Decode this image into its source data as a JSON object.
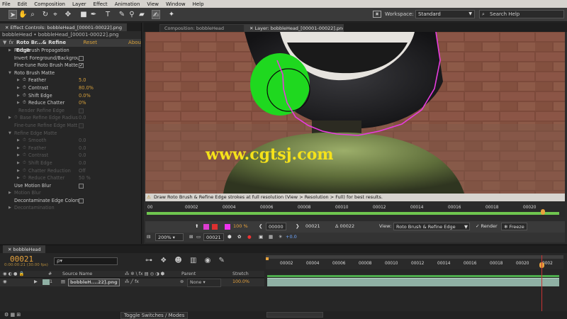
{
  "menubar": [
    "File",
    "Edit",
    "Composition",
    "Layer",
    "Effect",
    "Animation",
    "View",
    "Window",
    "Help"
  ],
  "workspace": {
    "label": "Workspace:",
    "value": "Standard"
  },
  "search": {
    "placeholder": "Search Help"
  },
  "effect_controls": {
    "tab": "Effect Controls: bobbleHead_[00001-00022].png",
    "title": "bobbleHead • bobbleHead_[00001-00022].png",
    "effect_name": "Roto Br...& Refine Edge",
    "reset": "Reset",
    "about": "Abou",
    "rows": [
      {
        "label": "Roto Brush Propagation",
        "indent": 1,
        "twirl": "right",
        "dim": false
      },
      {
        "label": "Invert Foreground/Backgrou",
        "indent": 1,
        "dim": false,
        "checkbox": false
      },
      {
        "label": "Fine-tune Roto Brush Matte",
        "indent": 1,
        "dim": false,
        "checkbox": true
      },
      {
        "label": "Roto Brush Matte",
        "indent": 1,
        "twirl": "down",
        "dim": false
      },
      {
        "label": "Feather",
        "indent": 3,
        "twirl": "right",
        "stopwatch": true,
        "value": "5.0",
        "dim": false
      },
      {
        "label": "Contrast",
        "indent": 3,
        "twirl": "right",
        "stopwatch": true,
        "value": "80.0%",
        "dim": false
      },
      {
        "label": "Shift Edge",
        "indent": 3,
        "twirl": "right",
        "stopwatch": true,
        "value": "0.0%",
        "dim": false
      },
      {
        "label": "Reduce Chatter",
        "indent": 3,
        "twirl": "right",
        "stopwatch": true,
        "value": "0%",
        "dim": false
      },
      {
        "label": "Render Refine Edge",
        "indent": 2,
        "dim": true,
        "checkbox": false
      },
      {
        "label": "Base Refine Edge Radius",
        "indent": 1,
        "twirl": "right",
        "stopwatch": true,
        "value": "0.0",
        "dim": true
      },
      {
        "label": "Fine-tune Refine Edge Matt",
        "indent": 1,
        "dim": true,
        "checkbox": false
      },
      {
        "label": "Refine Edge Matte",
        "indent": 1,
        "twirl": "down",
        "dim": true
      },
      {
        "label": "Smooth",
        "indent": 3,
        "twirl": "right",
        "stopwatch": true,
        "value": "0.0",
        "dim": true
      },
      {
        "label": "Feather",
        "indent": 3,
        "twirl": "right",
        "stopwatch": true,
        "value": "0.0",
        "dim": true
      },
      {
        "label": "Contrast",
        "indent": 3,
        "twirl": "right",
        "stopwatch": true,
        "value": "0.0",
        "dim": true
      },
      {
        "label": "Shift Edge",
        "indent": 3,
        "twirl": "right",
        "stopwatch": true,
        "value": "0.0",
        "dim": true
      },
      {
        "label": "Chatter Reduction",
        "indent": 3,
        "twirl": "right",
        "stopwatch": true,
        "value": "Off",
        "dim": true
      },
      {
        "label": "Reduce Chatter",
        "indent": 3,
        "twirl": "right",
        "stopwatch": true,
        "value": "50 %",
        "dim": true
      },
      {
        "label": "Use Motion Blur",
        "indent": 1,
        "dim": false,
        "checkbox": false
      },
      {
        "label": "Motion Blur",
        "indent": 1,
        "twirl": "right",
        "dim": true
      },
      {
        "label": "Decontaminate Edge Colors",
        "indent": 1,
        "dim": false,
        "checkbox": false
      },
      {
        "label": "Decontamination",
        "indent": 1,
        "twirl": "right",
        "dim": true
      }
    ]
  },
  "comp_tabs": {
    "composition": "Composition: bobbleHead",
    "layer": "Layer: bobbleHead_[00001-00022].png"
  },
  "viewer": {
    "watermark": "www.cgtsj.com"
  },
  "warning": "Draw Roto Brush & Refine Edge strokes at full resolution (View > Resolution > Full) for best results.",
  "layer_ruler": [
    "00",
    "00002",
    "00004",
    "00006",
    "00008",
    "00010",
    "00012",
    "00014",
    "00016",
    "00018",
    "00020"
  ],
  "comp_controls": {
    "percent": "100 %",
    "start": "00000",
    "current": "00021",
    "delta": "Δ 00022",
    "view_label": "View:",
    "view_value": "Roto Brush & Refine Edge",
    "render_label": "Render",
    "freeze_label": "Freeze",
    "zoom": "200%",
    "frame": "00021",
    "exposure": "+0.0"
  },
  "timeline": {
    "tab": "bobbleHead",
    "current_time": "00021",
    "sub_time": "0:00:00:21 (30.00 fps)",
    "search_placeholder": "ρ▾",
    "col_source": "Source Name",
    "col_parent": "Parent",
    "col_stretch": "Stretch",
    "layer_index": "1",
    "layer_name": "bobbleH....22].png",
    "parent_value": "None",
    "stretch_value": "100.0%",
    "ruler": [
      "00002",
      "00004",
      "00006",
      "00008",
      "00010",
      "00012",
      "00014",
      "00016",
      "00018",
      "00020",
      "0002"
    ],
    "toggle": "Toggle Switches / Modes"
  },
  "colors": {
    "accent": "#e8a33d",
    "matte": "#1fd81f",
    "edge": "#e83ce0",
    "track": "#8fb0a4"
  }
}
